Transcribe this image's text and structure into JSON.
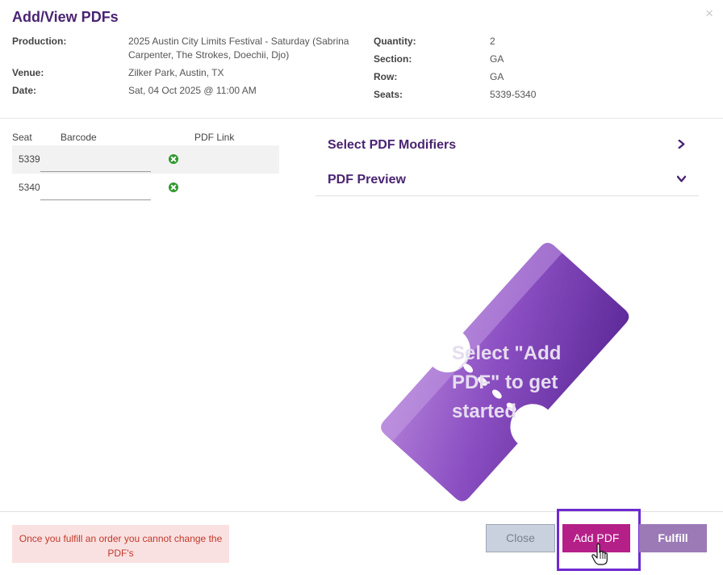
{
  "modal": {
    "title": "Add/View PDFs",
    "close_glyph": "×"
  },
  "details_left": [
    {
      "label": "Production:",
      "value": "2025 Austin City Limits Festival - Saturday (Sabrina Carpenter, The Strokes, Doechii, Djo)"
    },
    {
      "label": "Venue:",
      "value": "Zilker Park, Austin, TX"
    },
    {
      "label": "Date:",
      "value": "Sat, 04 Oct 2025 @ 11:00 AM"
    }
  ],
  "details_right": [
    {
      "label": "Quantity:",
      "value": "2"
    },
    {
      "label": "Section:",
      "value": "GA"
    },
    {
      "label": "Row:",
      "value": "GA"
    },
    {
      "label": "Seats:",
      "value": "5339-5340"
    }
  ],
  "seat_table": {
    "headers": {
      "seat": "Seat",
      "barcode": "Barcode",
      "pdf_link": "PDF Link"
    },
    "rows": [
      {
        "seat": "5339",
        "barcode": ""
      },
      {
        "seat": "5340",
        "barcode": ""
      }
    ]
  },
  "accordion": {
    "modifiers": "Select PDF Modifiers",
    "preview": "PDF Preview"
  },
  "preview": {
    "placeholder": "Select \"Add PDF\" to get started"
  },
  "footer": {
    "warning": "Once you fulfill an order you cannot change the PDF's",
    "close": "Close",
    "add_pdf": "Add PDF",
    "fulfill": "Fulfill"
  },
  "icons": {
    "close": "close-icon",
    "remove": "remove-circle-icon",
    "chevron_right": "chevron-right-icon",
    "chevron_down": "chevron-down-icon",
    "ticket": "ticket-icon",
    "cursor": "hand-pointer-icon"
  },
  "colors": {
    "title_purple": "#4a2472",
    "add_pdf": "#b51f88",
    "fulfill": "#9b7ab6",
    "highlight": "#6e2ad1",
    "warning_bg": "#fae1e1",
    "warning_text": "#c0392b",
    "remove_green": "#2e9a2e"
  }
}
